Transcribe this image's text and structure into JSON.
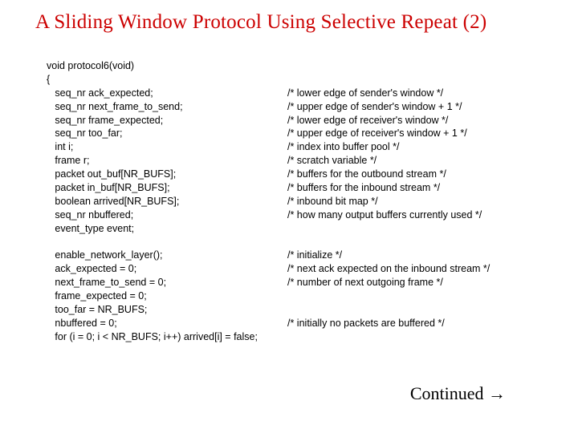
{
  "title": "A Sliding Window Protocol Using Selective Repeat (2)",
  "code": {
    "sig": "void protocol6(void)",
    "open": "{",
    "decl": [
      {
        "c": "   seq_nr ack_expected;",
        "m": "/* lower edge of sender's window */"
      },
      {
        "c": "   seq_nr next_frame_to_send;",
        "m": "/* upper edge of sender's window + 1 */"
      },
      {
        "c": "   seq_nr frame_expected;",
        "m": "/* lower edge of receiver's window */"
      },
      {
        "c": "   seq_nr too_far;",
        "m": "/* upper edge of receiver's window + 1 */"
      },
      {
        "c": "   int i;",
        "m": "/* index into buffer pool */"
      },
      {
        "c": "   frame r;",
        "m": "/* scratch variable */"
      },
      {
        "c": "   packet out_buf[NR_BUFS];",
        "m": "/* buffers for the outbound stream */"
      },
      {
        "c": "   packet in_buf[NR_BUFS];",
        "m": "/* buffers for the inbound stream */"
      },
      {
        "c": "   boolean arrived[NR_BUFS];",
        "m": "/* inbound bit map */"
      },
      {
        "c": "   seq_nr nbuffered;",
        "m": "/* how many output buffers currently used */"
      },
      {
        "c": "   event_type event;",
        "m": ""
      }
    ],
    "init": [
      {
        "c": "   enable_network_layer();",
        "m": "/* initialize */"
      },
      {
        "c": "   ack_expected = 0;",
        "m": "/* next ack expected on the inbound stream */"
      },
      {
        "c": "   next_frame_to_send = 0;",
        "m": "/* number of next outgoing frame */"
      },
      {
        "c": "   frame_expected = 0;",
        "m": ""
      },
      {
        "c": "   too_far = NR_BUFS;",
        "m": ""
      },
      {
        "c": "   nbuffered = 0;",
        "m": "/* initially no packets are buffered */"
      },
      {
        "c": "   for (i = 0; i < NR_BUFS; i++) arrived[i] = false;",
        "m": ""
      }
    ]
  },
  "continued": "Continued →"
}
